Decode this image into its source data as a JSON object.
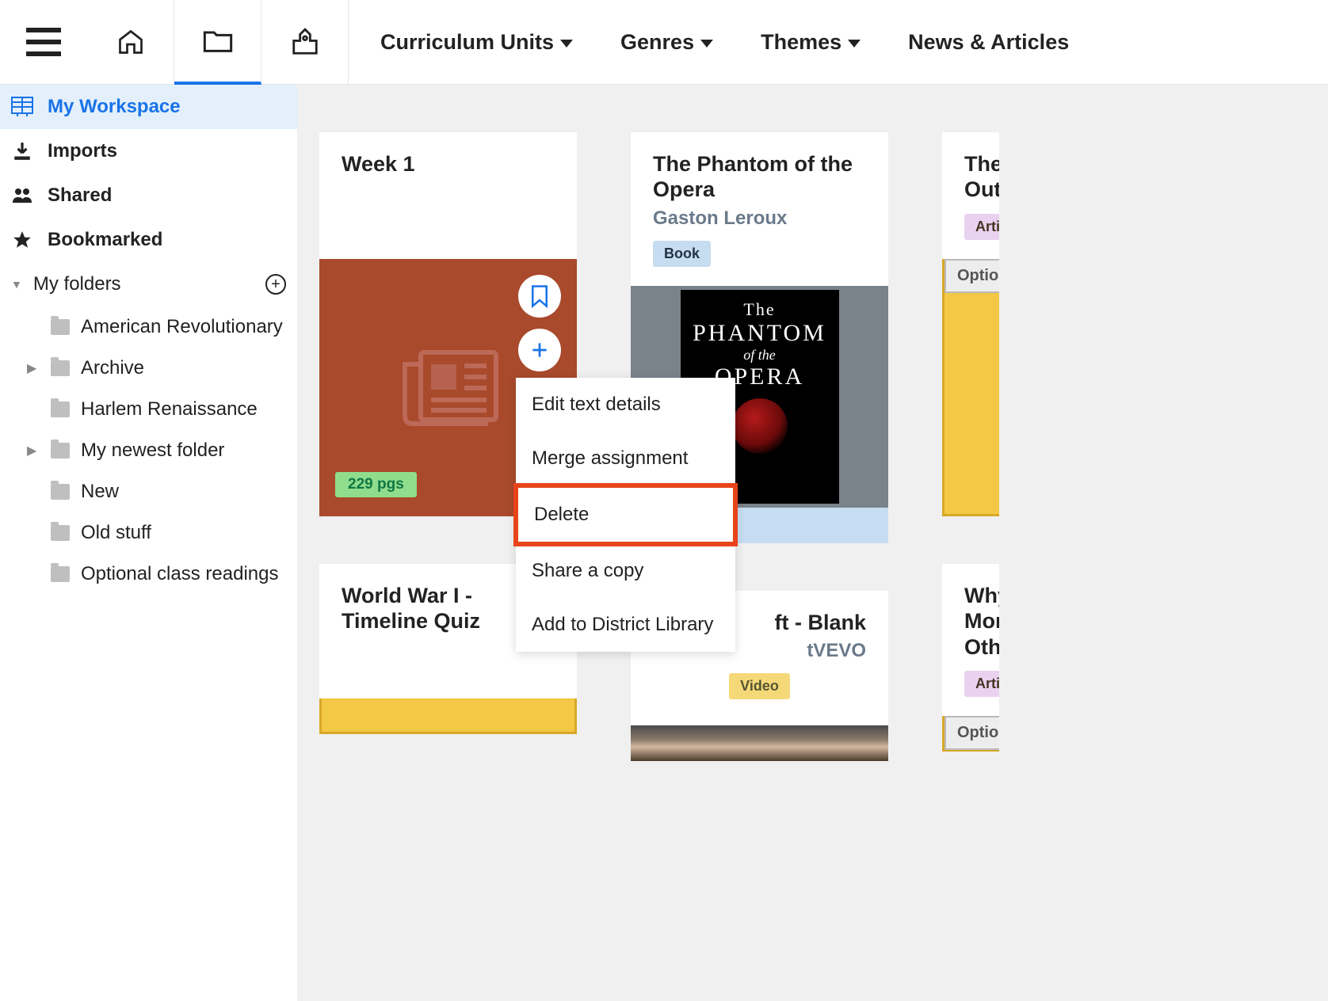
{
  "header": {
    "nav": [
      "Curriculum Units",
      "Genres",
      "Themes",
      "News & Articles"
    ]
  },
  "sidebar": {
    "workspace": "My Workspace",
    "imports": "Imports",
    "shared": "Shared",
    "bookmarked": "Bookmarked",
    "folders_label": "My folders",
    "folders": [
      {
        "label": "American Revolutionary",
        "expandable": false
      },
      {
        "label": "Archive",
        "expandable": true
      },
      {
        "label": "Harlem Renaissance",
        "expandable": false
      },
      {
        "label": "My newest folder",
        "expandable": true
      },
      {
        "label": "New",
        "expandable": false
      },
      {
        "label": "Old stuff",
        "expandable": false
      },
      {
        "label": "Optional class readings",
        "expandable": false
      }
    ]
  },
  "cards": {
    "week1": {
      "title": "Week 1",
      "pages": "229 pgs"
    },
    "phantom": {
      "title": "The Phantom of the Opera",
      "author": "Gaston Leroux",
      "badge": "Book"
    },
    "partial1": {
      "title": "The",
      "title2": "Out\"",
      "badge": "Arti",
      "optional": "Optiona"
    },
    "ww1": {
      "title": "World War I - Timeline Quiz"
    },
    "taylor": {
      "title": "ft - Blank",
      "author": "tVEVO",
      "badge": "Video"
    },
    "why": {
      "title": "Why",
      "title2": "More",
      "title3": "Othe",
      "badge": "Arti",
      "optional": "Optiona"
    }
  },
  "menu": {
    "edit": "Edit text details",
    "merge": "Merge assignment",
    "delete": "Delete",
    "share": "Share a copy",
    "district": "Add to District Library"
  }
}
